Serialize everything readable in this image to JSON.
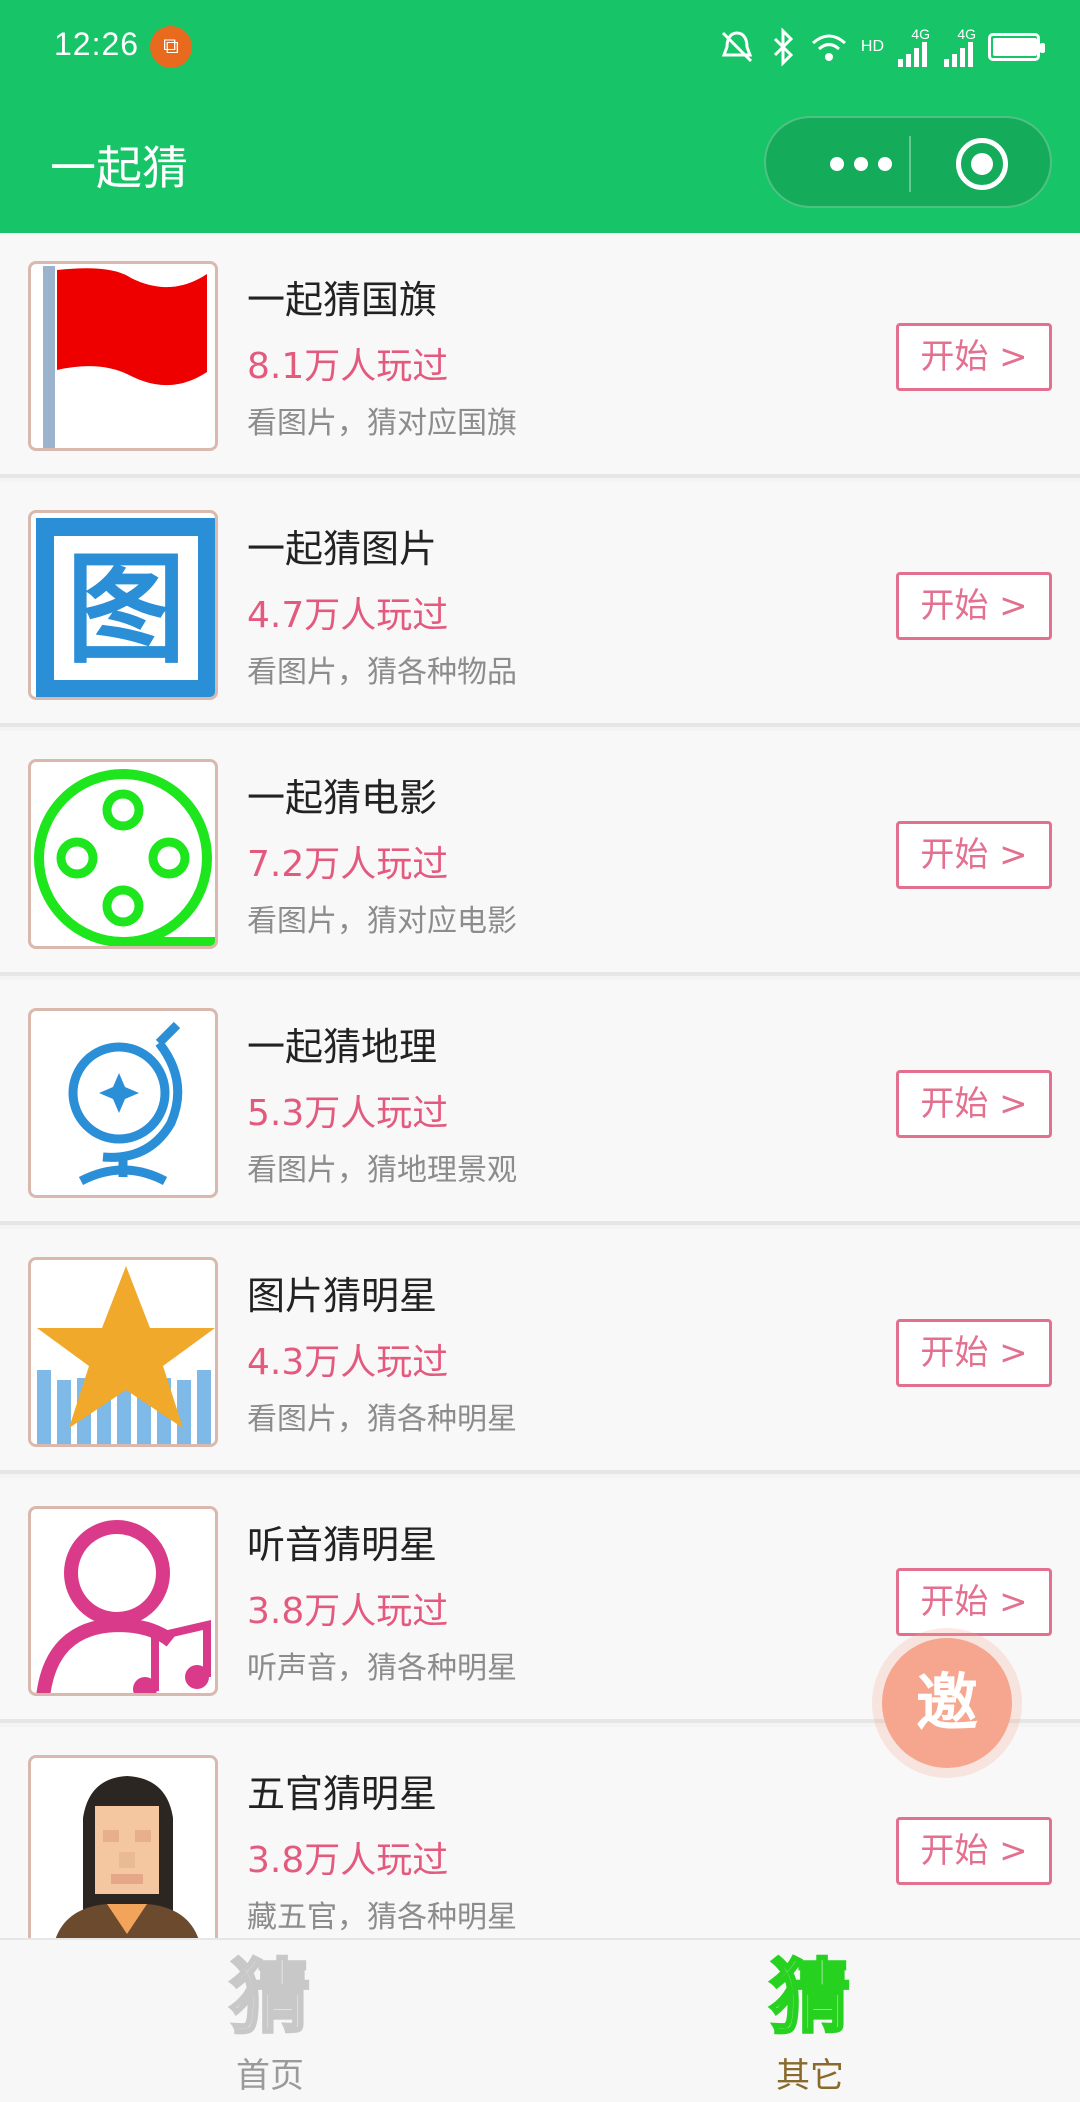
{
  "status": {
    "time": "12:26",
    "notif_glyph": "⧉",
    "net1": "4G",
    "net2": "4G",
    "hd": "HD"
  },
  "header": {
    "title": "一起猜"
  },
  "colors": {
    "brand": "#17c467",
    "accent": "#e2708e",
    "plays": "#e35a7e"
  },
  "items": [
    {
      "name": "一起猜国旗",
      "plays": "8.1万人玩过",
      "desc": "看图片，猜对应国旗",
      "button": "开始 >",
      "icon": "red-flag-icon"
    },
    {
      "name": "一起猜图片",
      "plays": "4.7万人玩过",
      "desc": "看图片，猜各种物品",
      "button": "开始 >",
      "icon": "tu-character-icon"
    },
    {
      "name": "一起猜电影",
      "plays": "7.2万人玩过",
      "desc": "看图片，猜对应电影",
      "button": "开始 >",
      "icon": "film-reel-icon"
    },
    {
      "name": "一起猜地理",
      "plays": "5.3万人玩过",
      "desc": "看图片，猜地理景观",
      "button": "开始 >",
      "icon": "globe-icon"
    },
    {
      "name": "图片猜明星",
      "plays": "4.3万人玩过",
      "desc": "看图片，猜各种明星",
      "button": "开始 >",
      "icon": "star-icon"
    },
    {
      "name": "听音猜明星",
      "plays": "3.8万人玩过",
      "desc": "听声音，猜各种明星",
      "button": "开始 >",
      "icon": "person-music-icon"
    },
    {
      "name": "五官猜明星",
      "plays": "3.8万人玩过",
      "desc": "藏五官，猜各种明星",
      "button": "开始 >",
      "icon": "pixel-face-icon"
    }
  ],
  "tu_glyph": "图",
  "invite": {
    "label": "邀"
  },
  "tabs": [
    {
      "icon_glyph": "猜",
      "label": "首页",
      "active": false
    },
    {
      "icon_glyph": "猜",
      "label": "其它",
      "active": true
    }
  ]
}
